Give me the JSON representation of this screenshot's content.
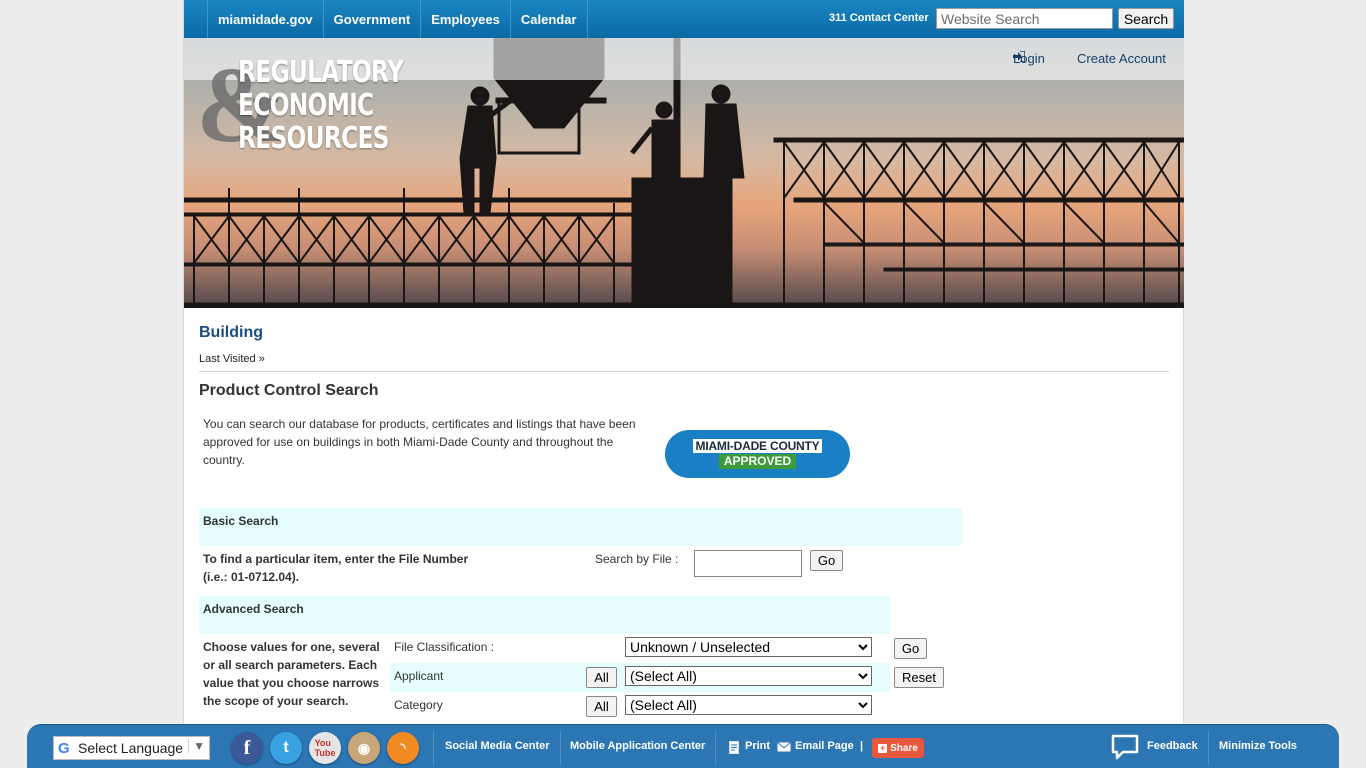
{
  "topnav": {
    "links": [
      "miamidade.gov",
      "Government",
      "Employees",
      "Calendar"
    ],
    "contact": "311 Contact Center",
    "search_placeholder": "Website Search",
    "search_button": "Search"
  },
  "banner": {
    "logo_line1": "REGULATORY",
    "logo_line2": "ECONOMIC",
    "logo_line3": "RESOURCES",
    "logo_amp": "&",
    "login": "Login",
    "create_account": "Create Account"
  },
  "content": {
    "heading": "Building",
    "last_visited": "Last Visited »",
    "title": "Product Control Search",
    "intro": "You can search our database for products, certificates and listings that have been approved for use on buildings in both Miami-Dade County and throughout the country.",
    "badge_line1": "MIAMI-DADE COUNTY",
    "badge_line2": "APPROVED",
    "basic_title": "Basic Search",
    "basic_text": "To find a particular item, enter the File Number (i.e.: 01-0712.04).",
    "file_label": "Search by File :",
    "file_value": "",
    "go": "Go",
    "advanced_title": "Advanced Search",
    "advanced_text": "Choose values for one, several or all search parameters. Each value that you choose narrows the scope of your search.",
    "rows": [
      {
        "label": "File Classification :",
        "all": "",
        "value": "Unknown / Unselected"
      },
      {
        "label": "Applicant",
        "all": "All",
        "value": "(Select All)"
      },
      {
        "label": "Category",
        "all": "All",
        "value": "(Select All)"
      }
    ],
    "reset": "Reset"
  },
  "toolbar": {
    "language": "Select Language",
    "social": [
      "facebook-icon",
      "twitter-icon",
      "youtube-icon",
      "instagram-icon",
      "rss-icon"
    ],
    "social_media_center": "Social Media Center",
    "mobile_center": "Mobile Application Center",
    "print": "Print",
    "email": "Email Page",
    "divider": "|",
    "share": "Share",
    "feedback": "Feedback",
    "minimize": "Minimize Tools",
    "colors": {
      "bar": "#2c76b4",
      "share": "#e8583e"
    }
  }
}
